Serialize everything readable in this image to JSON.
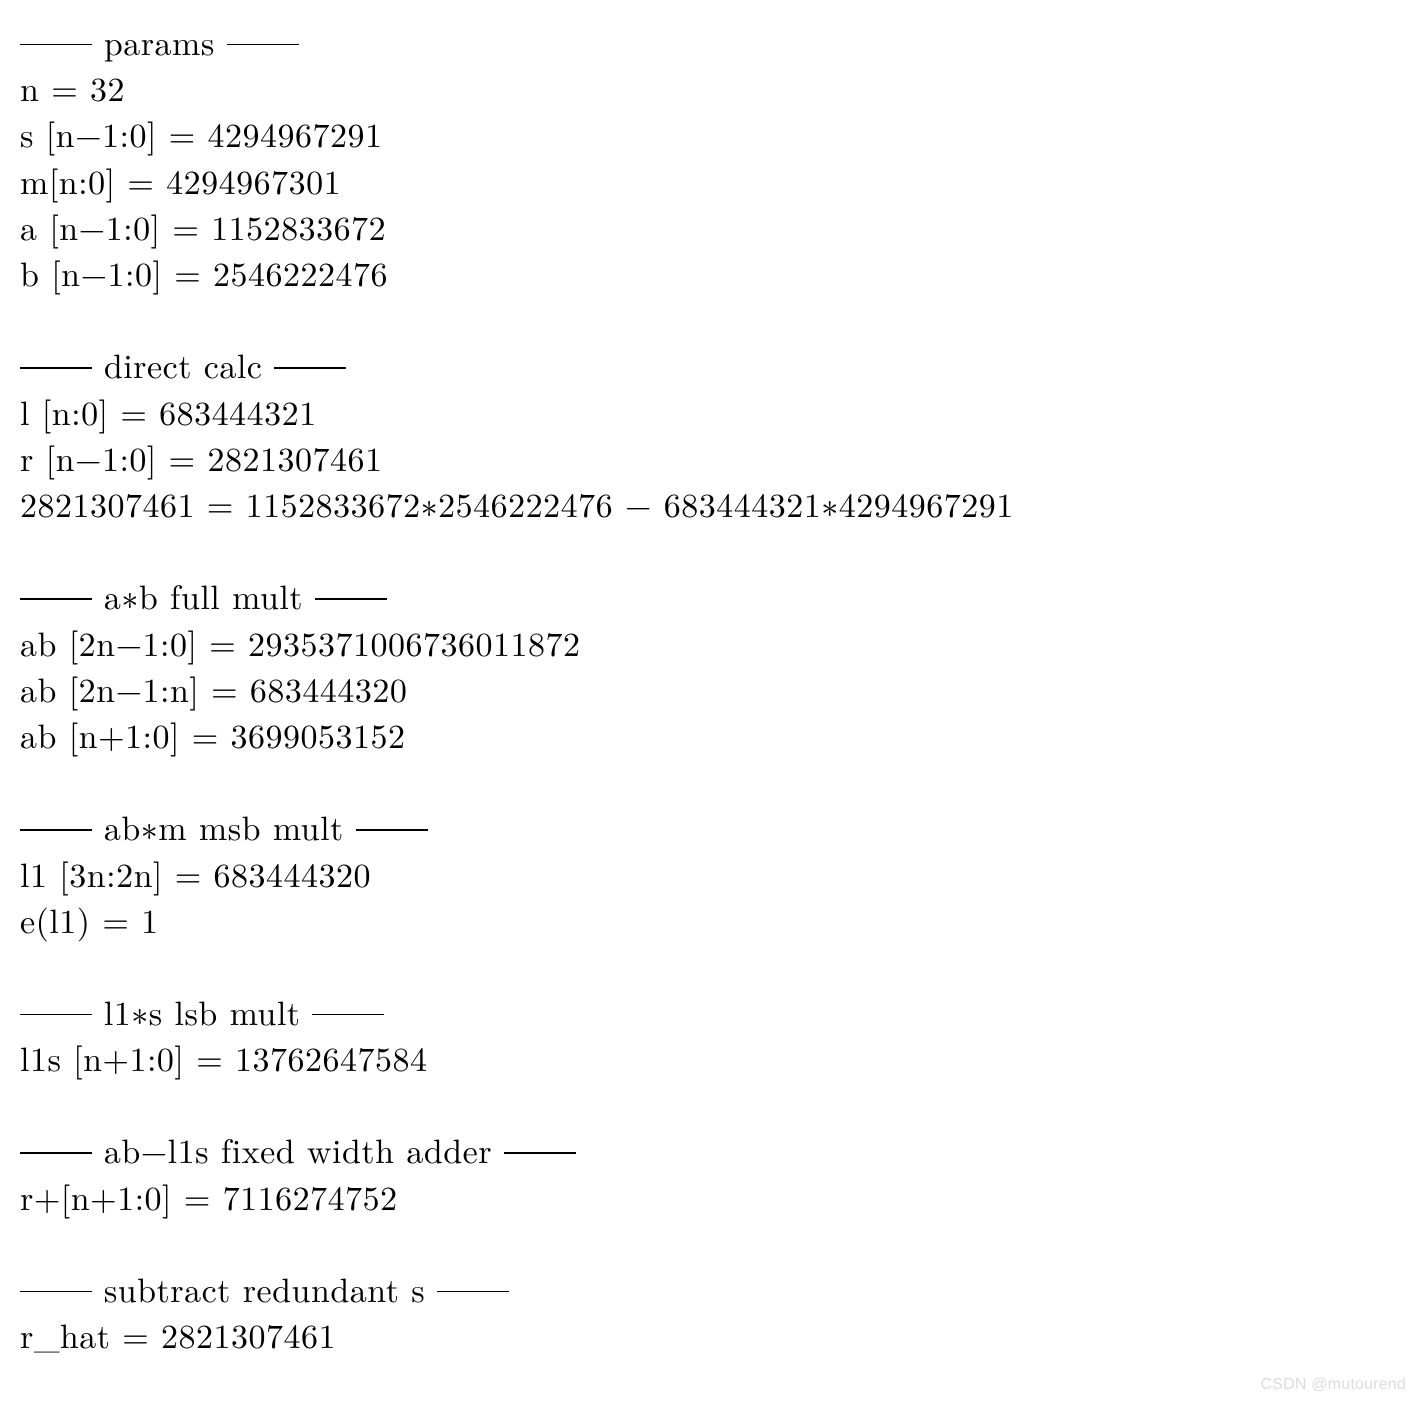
{
  "sections": {
    "params": {
      "header": " params ",
      "lines": [
        "n = 32",
        "s [n−1:0] = 4294967291",
        "m[n:0] = 4294967301",
        "a [n−1:0] = 1152833672",
        "b [n−1:0] = 2546222476"
      ]
    },
    "direct_calc": {
      "header": " direct calc ",
      "lines": [
        "l [n:0] = 683444321",
        "r [n−1:0] = 2821307461",
        "2821307461 = 1152833672∗2546222476 − 683444321∗4294967291"
      ]
    },
    "ab_full_mult": {
      "header": " a∗b full mult ",
      "lines": [
        "ab [2n−1:0] = 2935371006736011872",
        "ab [2n−1:n] = 683444320",
        "ab [n+1:0] = 3699053152"
      ]
    },
    "abm_msb_mult": {
      "header": " ab∗m msb mult ",
      "lines": [
        "l1 [3n:2n] = 683444320",
        "e(l1) = 1"
      ]
    },
    "l1s_lsb_mult": {
      "header": " l1∗s lsb mult ",
      "lines": [
        "l1s [n+1:0] = 13762647584"
      ]
    },
    "ab_l1s_adder": {
      "header": " ab−l1s fixed width adder ",
      "lines": [
        "r+[n+1:0] = 7116274752"
      ]
    },
    "subtract_redundant": {
      "header": " subtract redundant s ",
      "lines": [
        "r_hat = 2821307461"
      ]
    }
  },
  "watermark": "CSDN @mutourend"
}
